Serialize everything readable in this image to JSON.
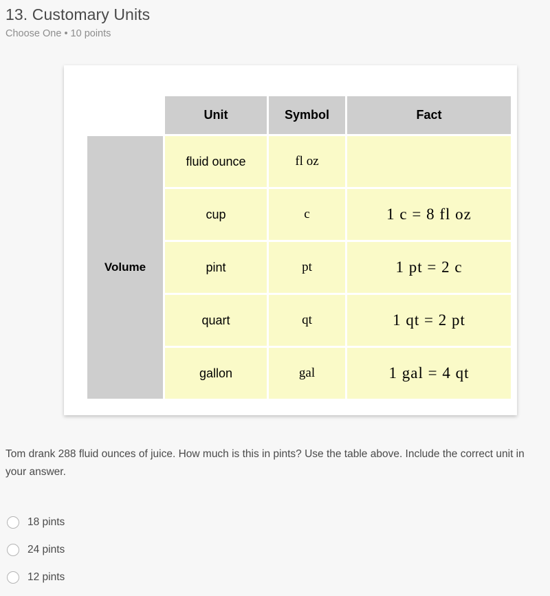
{
  "header": {
    "title": "13. Customary Units",
    "subtitle": "Choose One • 10 points"
  },
  "table": {
    "row_group_label": "Volume",
    "columns": [
      "Unit",
      "Symbol",
      "Fact"
    ],
    "rows": [
      {
        "unit": "fluid ounce",
        "symbol": "fl oz",
        "fact": ""
      },
      {
        "unit": "cup",
        "symbol": "c",
        "fact": "1 c  =  8 fl oz"
      },
      {
        "unit": "pint",
        "symbol": "pt",
        "fact": "1 pt  =  2 c"
      },
      {
        "unit": "quart",
        "symbol": "qt",
        "fact": "1 qt  =  2 pt"
      },
      {
        "unit": "gallon",
        "symbol": "gal",
        "fact": "1 gal  =  4 qt"
      }
    ]
  },
  "prompt": "Tom drank 288 fluid ounces of juice. How much is this in pints? Use the table above. Include the correct unit in your answer.",
  "options": [
    {
      "label": "18 pints",
      "selected": false
    },
    {
      "label": "24 pints",
      "selected": false
    },
    {
      "label": "12 pints",
      "selected": false
    }
  ],
  "colors": {
    "page_background": "#f7f7f7",
    "card_background": "#ffffff",
    "header_cell": "#cecece",
    "data_cell": "#fafac8",
    "title_text": "#4a4a4a",
    "subtitle_text": "#8d8d8d",
    "radio_border": "#b4b4b4"
  }
}
